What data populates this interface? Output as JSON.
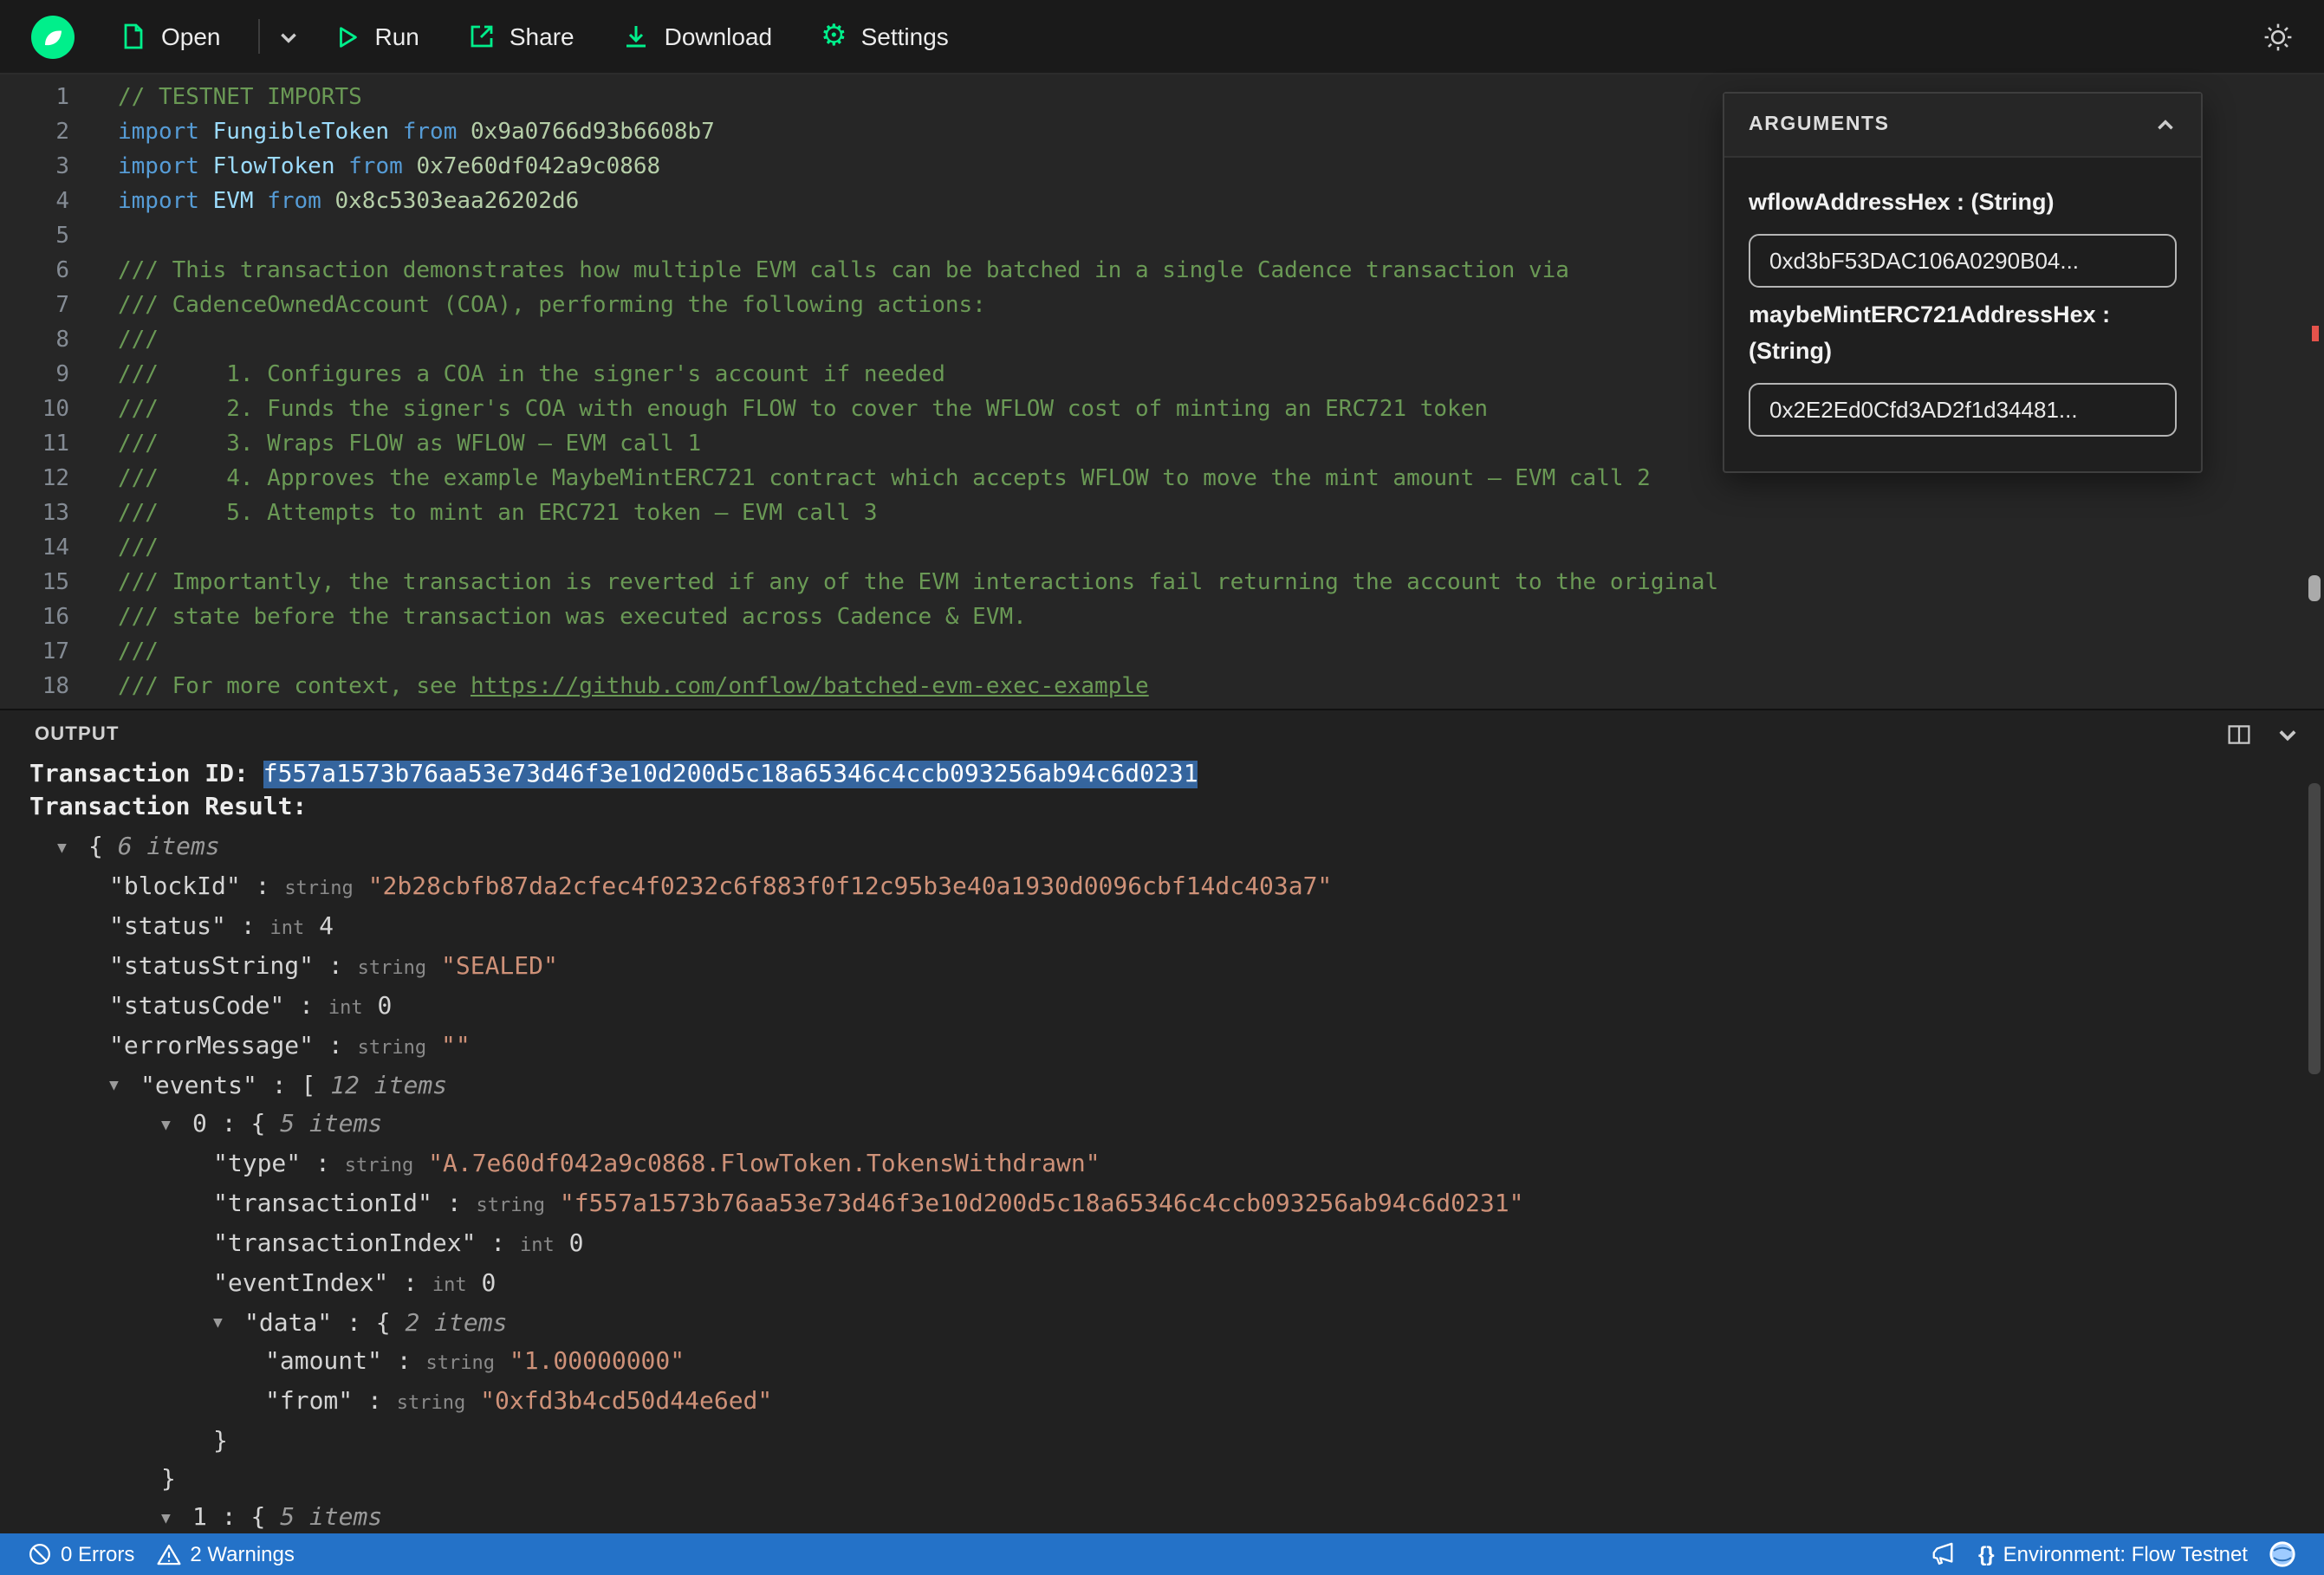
{
  "topbar": {
    "menu": [
      {
        "label": "Open"
      },
      {
        "label": "Run"
      },
      {
        "label": "Share"
      },
      {
        "label": "Download"
      },
      {
        "label": "Settings"
      }
    ]
  },
  "editor": {
    "lines": [
      {
        "n": "1",
        "segs": [
          [
            "// TESTNET IMPORTS",
            "cm"
          ]
        ]
      },
      {
        "n": "2",
        "segs": [
          [
            "import ",
            "kw"
          ],
          [
            "FungibleToken",
            "ty"
          ],
          [
            " ",
            "pl"
          ],
          [
            "from",
            "kw"
          ],
          [
            " ",
            "pl"
          ],
          [
            "0x9a0766d93b6608b7",
            "ad"
          ]
        ]
      },
      {
        "n": "3",
        "segs": [
          [
            "import ",
            "kw"
          ],
          [
            "FlowToken",
            "ty"
          ],
          [
            " ",
            "pl"
          ],
          [
            "from",
            "kw"
          ],
          [
            " ",
            "pl"
          ],
          [
            "0x7e60df042a9c0868",
            "ad"
          ]
        ]
      },
      {
        "n": "4",
        "segs": [
          [
            "import ",
            "kw"
          ],
          [
            "EVM",
            "ty"
          ],
          [
            " ",
            "pl"
          ],
          [
            "from",
            "kw"
          ],
          [
            " ",
            "pl"
          ],
          [
            "0x8c5303eaa26202d6",
            "ad"
          ]
        ]
      },
      {
        "n": "5",
        "segs": []
      },
      {
        "n": "6",
        "segs": [
          [
            "/// This transaction demonstrates how multiple EVM calls can be batched in a single Cadence transaction via",
            "cm"
          ]
        ]
      },
      {
        "n": "7",
        "segs": [
          [
            "/// CadenceOwnedAccount (COA), performing the following actions:",
            "cm"
          ]
        ]
      },
      {
        "n": "8",
        "segs": [
          [
            "///",
            "cm"
          ]
        ]
      },
      {
        "n": "9",
        "segs": [
          [
            "///     1. Configures a COA in the signer's account if needed",
            "cm"
          ]
        ]
      },
      {
        "n": "10",
        "segs": [
          [
            "///     2. Funds the signer's COA with enough FLOW to cover the WFLOW cost of minting an ERC721 token",
            "cm"
          ]
        ]
      },
      {
        "n": "11",
        "segs": [
          [
            "///     3. Wraps FLOW as WFLOW — EVM call 1",
            "cm"
          ]
        ]
      },
      {
        "n": "12",
        "segs": [
          [
            "///     4. Approves the example MaybeMintERC721 contract which accepts WFLOW to move the mint amount — EVM call 2",
            "cm"
          ]
        ]
      },
      {
        "n": "13",
        "segs": [
          [
            "///     5. Attempts to mint an ERC721 token — EVM call 3",
            "cm"
          ]
        ]
      },
      {
        "n": "14",
        "segs": [
          [
            "///",
            "cm"
          ]
        ]
      },
      {
        "n": "15",
        "segs": [
          [
            "/// Importantly, the transaction is reverted if any of the EVM interactions fail returning the account to the original",
            "cm"
          ]
        ]
      },
      {
        "n": "16",
        "segs": [
          [
            "/// state before the transaction was executed across Cadence & EVM.",
            "cm"
          ]
        ]
      },
      {
        "n": "17",
        "segs": [
          [
            "///",
            "cm"
          ]
        ]
      },
      {
        "n": "18",
        "segs": [
          [
            "/// For more context, see ",
            "cm"
          ],
          [
            "https://github.com/onflow/batched-evm-exec-example",
            "lk"
          ]
        ]
      }
    ]
  },
  "arguments_panel": {
    "title": "ARGUMENTS",
    "fields": [
      {
        "label": "wflowAddressHex : (String)",
        "value": "0xd3bF53DAC106A0290B04..."
      },
      {
        "label": "maybeMintERC721AddressHex : (String)",
        "value": "0x2E2Ed0Cfd3AD2f1d34481..."
      }
    ]
  },
  "output": {
    "title": "OUTPUT",
    "transaction_id_label": "Transaction ID: ",
    "transaction_id": "f557a1573b76aa53e73d46f3e10d200d5c18a65346c4ccb093256ab94c6d0231",
    "transaction_result_label": "Transaction Result:",
    "tree": [
      {
        "i": 0,
        "a": true,
        "s": [
          [
            "{ ",
            "br"
          ],
          [
            "6 items",
            "it"
          ]
        ]
      },
      {
        "i": 1,
        "a": false,
        "s": [
          [
            "\"blockId\"",
            "k"
          ],
          [
            " : ",
            "p"
          ],
          [
            "string",
            "tl"
          ],
          [
            " ",
            "p"
          ],
          [
            "\"2b28cbfb87da2cfec4f0232c6f883f0f12c95b3e40a1930d0096cbf14dc403a7\"",
            "s"
          ]
        ]
      },
      {
        "i": 1,
        "a": false,
        "s": [
          [
            "\"status\"",
            "k"
          ],
          [
            " : ",
            "p"
          ],
          [
            "int",
            "tl"
          ],
          [
            " ",
            "p"
          ],
          [
            "4",
            "n"
          ]
        ]
      },
      {
        "i": 1,
        "a": false,
        "s": [
          [
            "\"statusString\"",
            "k"
          ],
          [
            " : ",
            "p"
          ],
          [
            "string",
            "tl"
          ],
          [
            " ",
            "p"
          ],
          [
            "\"SEALED\"",
            "s"
          ]
        ]
      },
      {
        "i": 1,
        "a": false,
        "s": [
          [
            "\"statusCode\"",
            "k"
          ],
          [
            " : ",
            "p"
          ],
          [
            "int",
            "tl"
          ],
          [
            " ",
            "p"
          ],
          [
            "0",
            "n"
          ]
        ]
      },
      {
        "i": 1,
        "a": false,
        "s": [
          [
            "\"errorMessage\"",
            "k"
          ],
          [
            " : ",
            "p"
          ],
          [
            "string",
            "tl"
          ],
          [
            " ",
            "p"
          ],
          [
            "\"\"",
            "s"
          ]
        ]
      },
      {
        "i": 1,
        "a": true,
        "s": [
          [
            "\"events\"",
            "k"
          ],
          [
            " : ",
            "p"
          ],
          [
            "[ ",
            "br"
          ],
          [
            "12 items",
            "it"
          ]
        ]
      },
      {
        "i": 2,
        "a": true,
        "s": [
          [
            "0",
            "k"
          ],
          [
            " : ",
            "p"
          ],
          [
            "{ ",
            "br"
          ],
          [
            "5 items",
            "it"
          ]
        ]
      },
      {
        "i": 3,
        "a": false,
        "s": [
          [
            "\"type\"",
            "k"
          ],
          [
            " : ",
            "p"
          ],
          [
            "string",
            "tl"
          ],
          [
            " ",
            "p"
          ],
          [
            "\"A.7e60df042a9c0868.FlowToken.TokensWithdrawn\"",
            "s"
          ]
        ]
      },
      {
        "i": 3,
        "a": false,
        "s": [
          [
            "\"transactionId\"",
            "k"
          ],
          [
            " : ",
            "p"
          ],
          [
            "string",
            "tl"
          ],
          [
            " ",
            "p"
          ],
          [
            "\"f557a1573b76aa53e73d46f3e10d200d5c18a65346c4ccb093256ab94c6d0231\"",
            "s"
          ]
        ]
      },
      {
        "i": 3,
        "a": false,
        "s": [
          [
            "\"transactionIndex\"",
            "k"
          ],
          [
            " : ",
            "p"
          ],
          [
            "int",
            "tl"
          ],
          [
            " ",
            "p"
          ],
          [
            "0",
            "n"
          ]
        ]
      },
      {
        "i": 3,
        "a": false,
        "s": [
          [
            "\"eventIndex\"",
            "k"
          ],
          [
            " : ",
            "p"
          ],
          [
            "int",
            "tl"
          ],
          [
            " ",
            "p"
          ],
          [
            "0",
            "n"
          ]
        ]
      },
      {
        "i": 3,
        "a": true,
        "s": [
          [
            "\"data\"",
            "k"
          ],
          [
            " : ",
            "p"
          ],
          [
            "{ ",
            "br"
          ],
          [
            "2 items",
            "it"
          ]
        ]
      },
      {
        "i": 4,
        "a": false,
        "s": [
          [
            "\"amount\"",
            "k"
          ],
          [
            " : ",
            "p"
          ],
          [
            "string",
            "tl"
          ],
          [
            " ",
            "p"
          ],
          [
            "\"1.00000000\"",
            "s"
          ]
        ]
      },
      {
        "i": 4,
        "a": false,
        "s": [
          [
            "\"from\"",
            "k"
          ],
          [
            " : ",
            "p"
          ],
          [
            "string",
            "tl"
          ],
          [
            " ",
            "p"
          ],
          [
            "\"0xfd3b4cd50d44e6ed\"",
            "s"
          ]
        ]
      },
      {
        "i": 3,
        "a": false,
        "s": [
          [
            "}",
            "br"
          ]
        ]
      },
      {
        "i": 2,
        "a": false,
        "s": [
          [
            "}",
            "br"
          ]
        ]
      },
      {
        "i": 2,
        "a": true,
        "s": [
          [
            "1",
            "k"
          ],
          [
            " : ",
            "p"
          ],
          [
            "{ ",
            "br"
          ],
          [
            "5 items",
            "it"
          ]
        ]
      }
    ]
  },
  "statusbar": {
    "errors": "0 Errors",
    "warnings": "2 Warnings",
    "braces_glyph": "{}",
    "environment": "Environment: Flow Testnet"
  },
  "colors": {
    "accent_green": "#00ef8b",
    "statusbar_blue": "#2472c8",
    "selection_blue": "#35659e",
    "comment_green": "#6a9955",
    "string_orange": "#ce9178",
    "error_red": "#e5534b"
  }
}
